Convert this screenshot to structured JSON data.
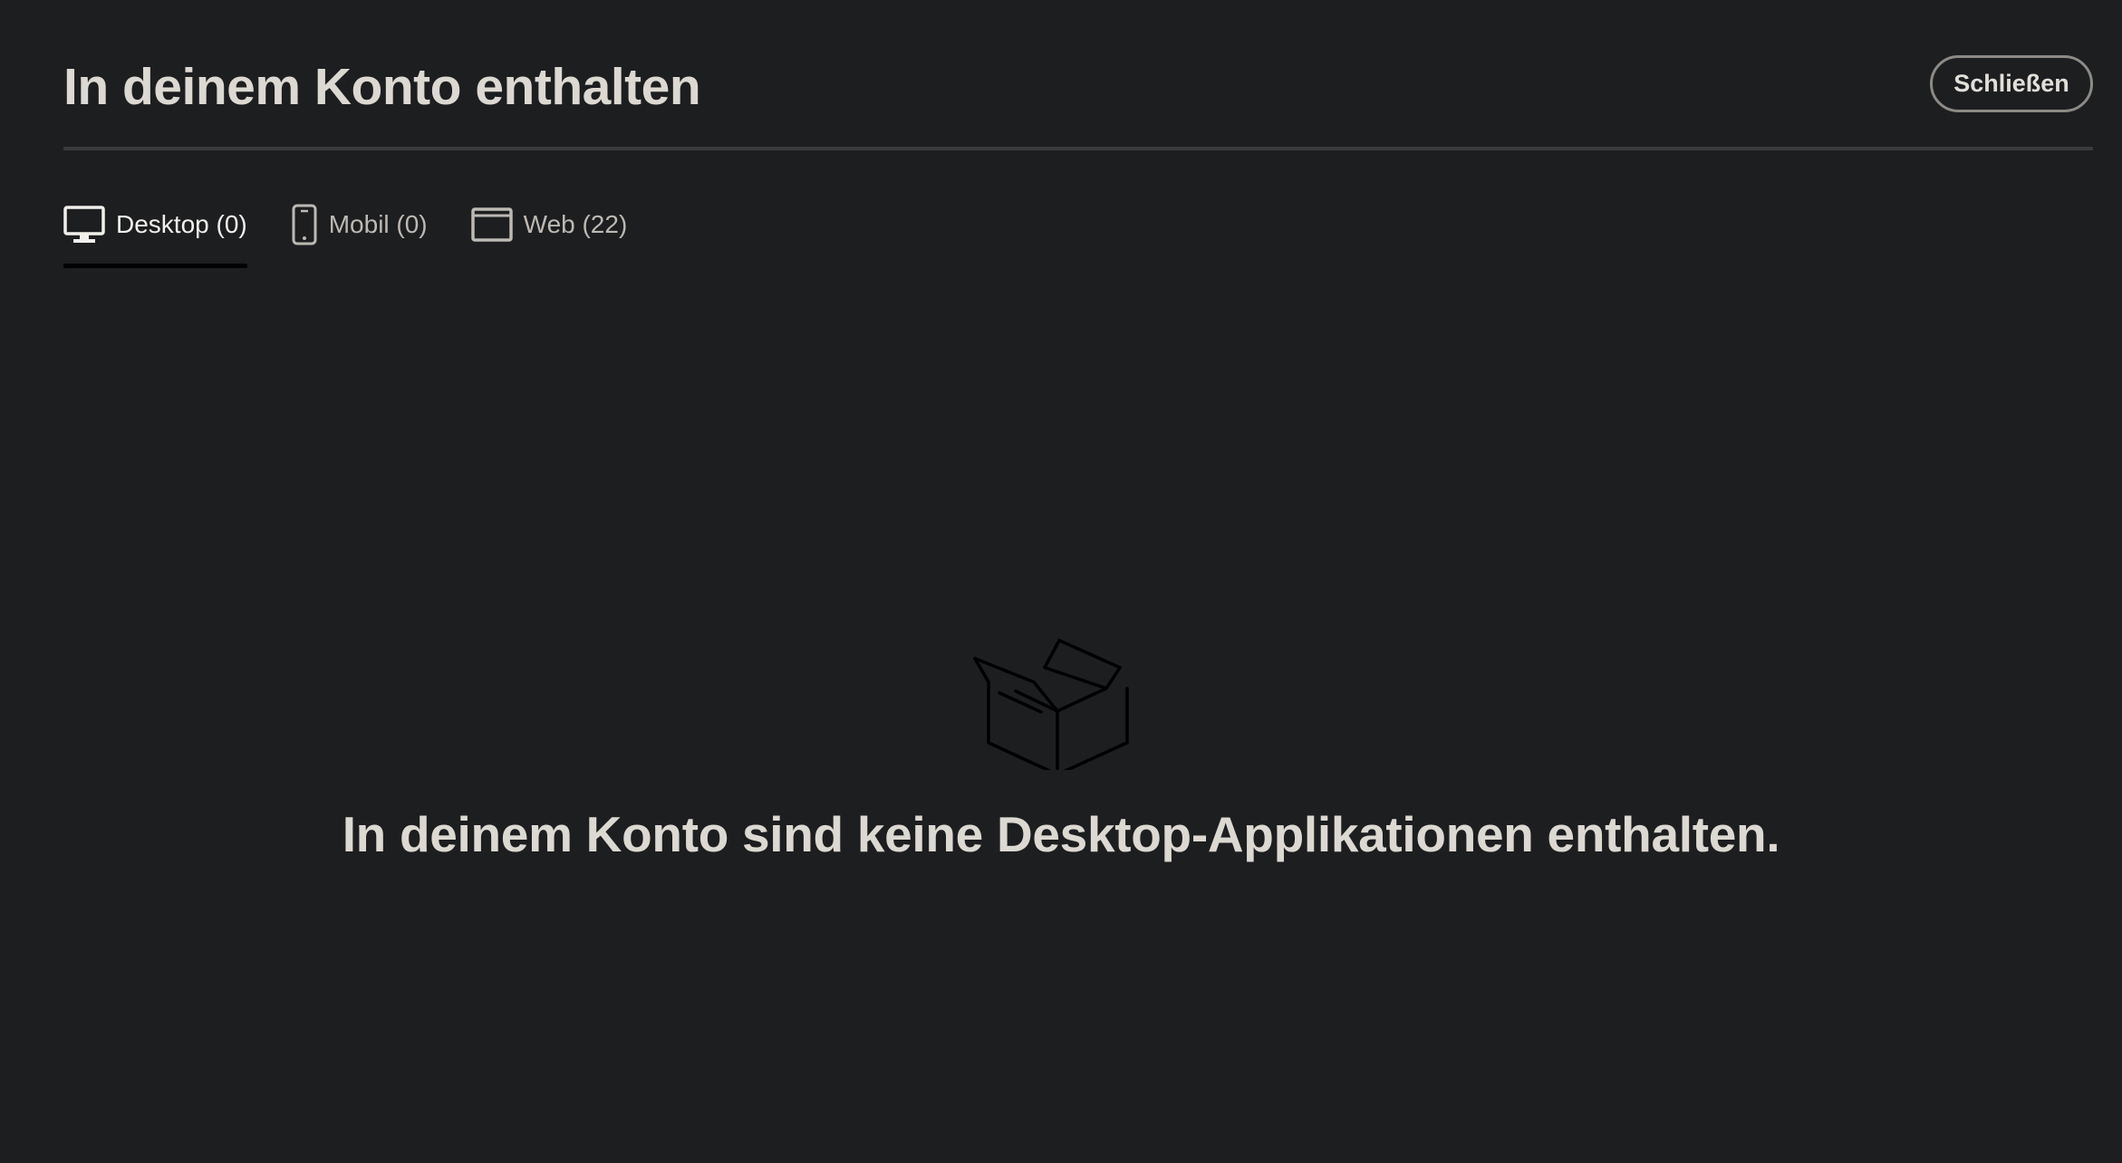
{
  "header": {
    "title": "In deinem Konto enthalten",
    "close_label": "Schließen"
  },
  "tabs": [
    {
      "label": "Desktop (0)",
      "icon": "desktop-icon",
      "active": true
    },
    {
      "label": "Mobil (0)",
      "icon": "mobile-icon",
      "active": false
    },
    {
      "label": "Web (22)",
      "icon": "web-icon",
      "active": false
    }
  ],
  "empty_state": {
    "icon": "open-box-icon",
    "message": "In deinem Konto sind keine Desktop-Applikationen enthalten."
  },
  "colors": {
    "background": "#1d1e20",
    "text": "#dcd8d2",
    "divider": "#3a3b3d",
    "active_tab_underline": "#000000"
  }
}
